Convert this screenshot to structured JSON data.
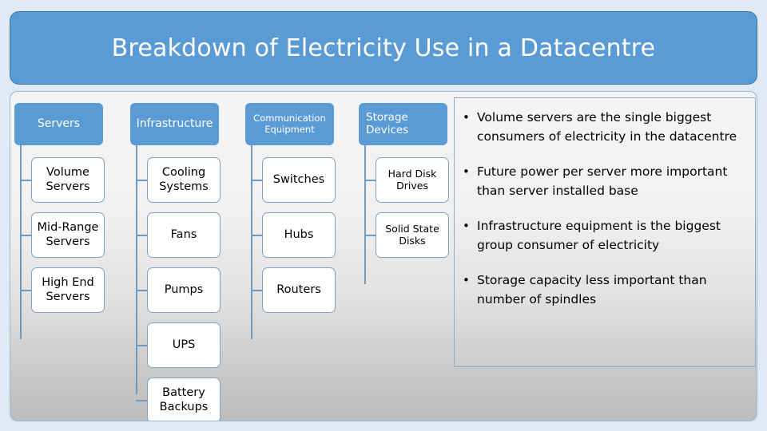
{
  "slide": {
    "title": "Breakdown of Electricity Use in a Datacentre",
    "accent_color": "#5b9bd5",
    "panel_border_color": "#9cb8d3",
    "box_border_color": "#7ba3c8",
    "page_background": "#dfeaf5"
  },
  "tree": {
    "columns": [
      {
        "header": "Servers",
        "children": [
          "Volume Servers",
          "Mid-Range Servers",
          "High End Servers"
        ]
      },
      {
        "header": "Infrastructure",
        "children": [
          "Cooling Systems",
          "Fans",
          "Pumps",
          "UPS",
          "Battery Backups"
        ]
      },
      {
        "header": "Communication Equipment",
        "children": [
          "Switches",
          "Hubs",
          "Routers"
        ]
      },
      {
        "header": "Storage Devices",
        "children": [
          "Hard Disk Drives",
          "Solid State Disks"
        ]
      }
    ]
  },
  "bullets": {
    "marker": "•",
    "items": [
      "Volume servers are the single biggest consumers of electricity in the datacentre",
      "Future power per server more important than server installed base",
      "Infrastructure equipment is the biggest group consumer of electricity",
      "Storage capacity less important than number of spindles"
    ]
  }
}
